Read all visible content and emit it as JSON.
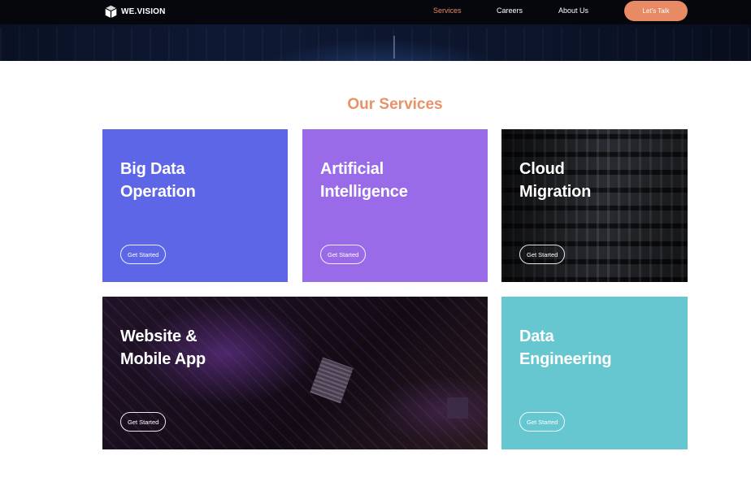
{
  "brand": {
    "name": "WE.VISION",
    "icon": "cube-logo-icon"
  },
  "nav": {
    "items": [
      {
        "label": "Services",
        "active": true
      },
      {
        "label": "Careers",
        "active": false
      },
      {
        "label": "About Us",
        "active": false
      }
    ],
    "cta_label": "Let's Talk"
  },
  "section": {
    "title": "Our Services"
  },
  "cards": [
    {
      "title_line1": "Big Data",
      "title_line2": "Operation",
      "button_label": "Get Started",
      "color": "#5c66e6"
    },
    {
      "title_line1": "Artificial",
      "title_line2": "Intelligence",
      "button_label": "Get Started",
      "color": "#9a6be8"
    },
    {
      "title_line1": "Cloud",
      "title_line2": "Migration",
      "button_label": "Get Started",
      "color": "#111216"
    },
    {
      "title_line1": "Website &",
      "title_line2": "Mobile App",
      "button_label": "Get Started",
      "color": "#140d17"
    },
    {
      "title_line1": "Data",
      "title_line2": "Engineering",
      "button_label": "Get Started",
      "color": "#66c7d0"
    }
  ],
  "colors": {
    "accent": "#e88a64",
    "header_bg": "#05070c"
  }
}
